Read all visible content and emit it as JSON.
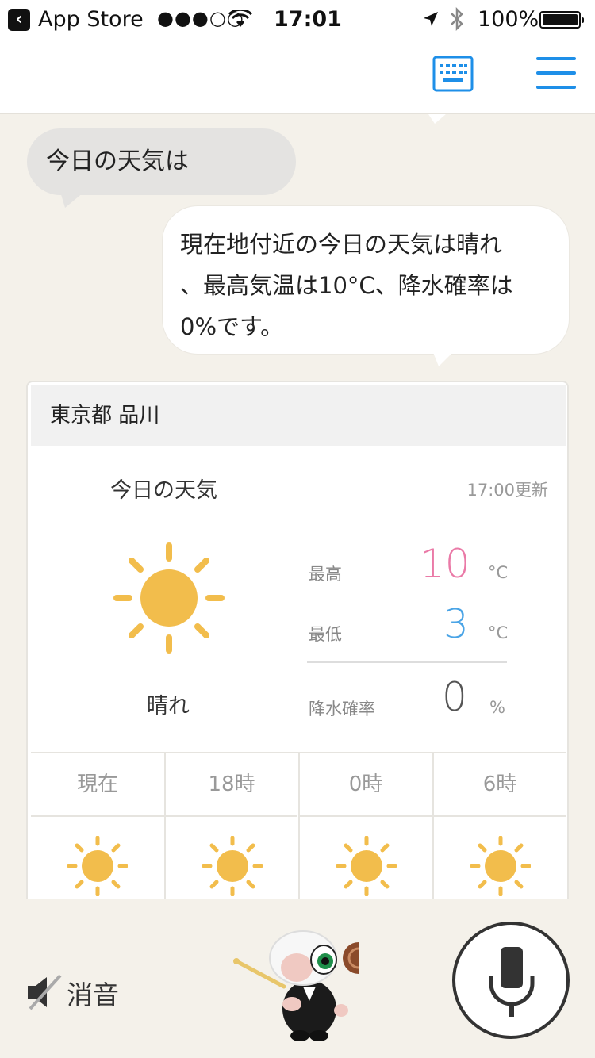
{
  "status_bar": {
    "back_app": "App Store",
    "signal": "●●●○○",
    "time": "17:01",
    "battery_percent": "100%"
  },
  "nav": {
    "keyboard_icon": "keyboard-icon",
    "menu_icon": "hamburger-menu-icon",
    "accent_color": "#1e8fe8"
  },
  "chat": {
    "user_message": "今日の天気は",
    "assistant_message_lines": [
      "現在地付近の今日の天気は晴れ",
      "、最高気温は10°C、降水確率は",
      "0%です。"
    ]
  },
  "weather_card": {
    "location": "東京都 品川",
    "title": "今日の天気",
    "updated": "17:00更新",
    "condition": "晴れ",
    "condition_icon": "sun-icon",
    "high_label": "最高",
    "high_value": "10",
    "high_unit": "°C",
    "high_color": "#ea7aa7",
    "low_label": "最低",
    "low_value": "3",
    "low_unit": "°C",
    "low_color": "#4aa4e6",
    "rain_label": "降水確率",
    "rain_value": "0",
    "rain_unit": "%",
    "hourly": [
      {
        "label": "現在",
        "icon": "sun-icon"
      },
      {
        "label": "18時",
        "icon": "sun-icon"
      },
      {
        "label": "0時",
        "icon": "sun-icon"
      },
      {
        "label": "6時",
        "icon": "sun-icon"
      }
    ]
  },
  "bottom_bar": {
    "mute_label": "消音",
    "mic_icon": "microphone-icon"
  }
}
